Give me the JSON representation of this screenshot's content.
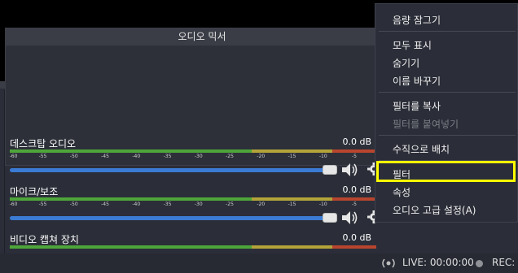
{
  "mixer": {
    "title": "오디오 믹서",
    "channels": [
      {
        "name": "데스크탑 오디오",
        "db": "0.0 dB"
      },
      {
        "name": "마이크/보조",
        "db": "0.0 dB"
      },
      {
        "name": "비디오 캡쳐 장치",
        "db": "0.0 dB"
      }
    ],
    "scale": [
      "-60",
      "-55",
      "-50",
      "-45",
      "-40",
      "-35",
      "-30",
      "-25",
      "-20",
      "-15",
      "-10",
      "-5",
      "0"
    ]
  },
  "context_menu": {
    "items": [
      {
        "label": "음량 잠그기",
        "enabled": true
      },
      {
        "label": "모두 표시",
        "enabled": true
      },
      {
        "label": "숨기기",
        "enabled": true
      },
      {
        "label": "이름 바꾸기",
        "enabled": true
      },
      {
        "label": "필터를 복사",
        "enabled": true
      },
      {
        "label": "필터를 붙여넣기",
        "enabled": false
      },
      {
        "label": "수직으로 배치",
        "enabled": true
      },
      {
        "label": "필터",
        "enabled": true,
        "highlighted": true
      },
      {
        "label": "속성",
        "enabled": true
      },
      {
        "label": "오디오 고급 설정(A)",
        "enabled": true
      }
    ]
  },
  "status": {
    "live": "LIVE: 00:00:00",
    "rec": "REC:"
  },
  "colors": {
    "highlight": "#ffff00",
    "slider": "#3b7bd4",
    "meter_green": "#4ea53a",
    "meter_yellow": "#b3a43a",
    "meter_red": "#b8452e"
  }
}
